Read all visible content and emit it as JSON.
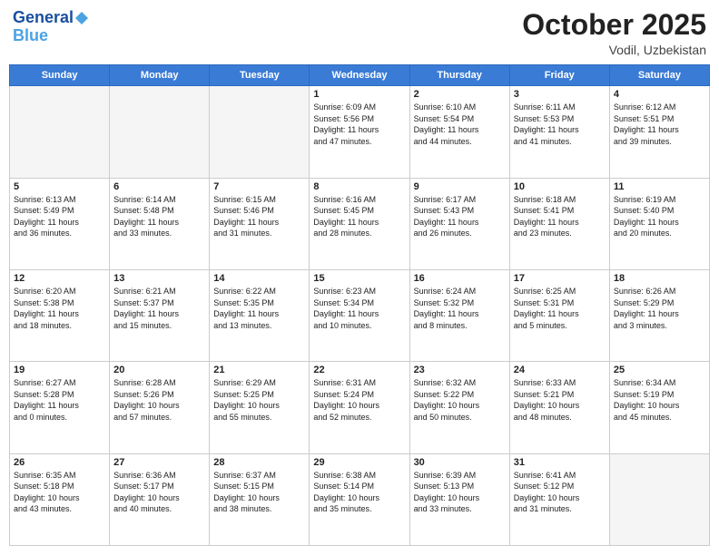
{
  "header": {
    "logo_line1": "General",
    "logo_line2": "Blue",
    "month": "October 2025",
    "location": "Vodil, Uzbekistan"
  },
  "days_of_week": [
    "Sunday",
    "Monday",
    "Tuesday",
    "Wednesday",
    "Thursday",
    "Friday",
    "Saturday"
  ],
  "weeks": [
    [
      {
        "day": "",
        "info": ""
      },
      {
        "day": "",
        "info": ""
      },
      {
        "day": "",
        "info": ""
      },
      {
        "day": "1",
        "info": "Sunrise: 6:09 AM\nSunset: 5:56 PM\nDaylight: 11 hours\nand 47 minutes."
      },
      {
        "day": "2",
        "info": "Sunrise: 6:10 AM\nSunset: 5:54 PM\nDaylight: 11 hours\nand 44 minutes."
      },
      {
        "day": "3",
        "info": "Sunrise: 6:11 AM\nSunset: 5:53 PM\nDaylight: 11 hours\nand 41 minutes."
      },
      {
        "day": "4",
        "info": "Sunrise: 6:12 AM\nSunset: 5:51 PM\nDaylight: 11 hours\nand 39 minutes."
      }
    ],
    [
      {
        "day": "5",
        "info": "Sunrise: 6:13 AM\nSunset: 5:49 PM\nDaylight: 11 hours\nand 36 minutes."
      },
      {
        "day": "6",
        "info": "Sunrise: 6:14 AM\nSunset: 5:48 PM\nDaylight: 11 hours\nand 33 minutes."
      },
      {
        "day": "7",
        "info": "Sunrise: 6:15 AM\nSunset: 5:46 PM\nDaylight: 11 hours\nand 31 minutes."
      },
      {
        "day": "8",
        "info": "Sunrise: 6:16 AM\nSunset: 5:45 PM\nDaylight: 11 hours\nand 28 minutes."
      },
      {
        "day": "9",
        "info": "Sunrise: 6:17 AM\nSunset: 5:43 PM\nDaylight: 11 hours\nand 26 minutes."
      },
      {
        "day": "10",
        "info": "Sunrise: 6:18 AM\nSunset: 5:41 PM\nDaylight: 11 hours\nand 23 minutes."
      },
      {
        "day": "11",
        "info": "Sunrise: 6:19 AM\nSunset: 5:40 PM\nDaylight: 11 hours\nand 20 minutes."
      }
    ],
    [
      {
        "day": "12",
        "info": "Sunrise: 6:20 AM\nSunset: 5:38 PM\nDaylight: 11 hours\nand 18 minutes."
      },
      {
        "day": "13",
        "info": "Sunrise: 6:21 AM\nSunset: 5:37 PM\nDaylight: 11 hours\nand 15 minutes."
      },
      {
        "day": "14",
        "info": "Sunrise: 6:22 AM\nSunset: 5:35 PM\nDaylight: 11 hours\nand 13 minutes."
      },
      {
        "day": "15",
        "info": "Sunrise: 6:23 AM\nSunset: 5:34 PM\nDaylight: 11 hours\nand 10 minutes."
      },
      {
        "day": "16",
        "info": "Sunrise: 6:24 AM\nSunset: 5:32 PM\nDaylight: 11 hours\nand 8 minutes."
      },
      {
        "day": "17",
        "info": "Sunrise: 6:25 AM\nSunset: 5:31 PM\nDaylight: 11 hours\nand 5 minutes."
      },
      {
        "day": "18",
        "info": "Sunrise: 6:26 AM\nSunset: 5:29 PM\nDaylight: 11 hours\nand 3 minutes."
      }
    ],
    [
      {
        "day": "19",
        "info": "Sunrise: 6:27 AM\nSunset: 5:28 PM\nDaylight: 11 hours\nand 0 minutes."
      },
      {
        "day": "20",
        "info": "Sunrise: 6:28 AM\nSunset: 5:26 PM\nDaylight: 10 hours\nand 57 minutes."
      },
      {
        "day": "21",
        "info": "Sunrise: 6:29 AM\nSunset: 5:25 PM\nDaylight: 10 hours\nand 55 minutes."
      },
      {
        "day": "22",
        "info": "Sunrise: 6:31 AM\nSunset: 5:24 PM\nDaylight: 10 hours\nand 52 minutes."
      },
      {
        "day": "23",
        "info": "Sunrise: 6:32 AM\nSunset: 5:22 PM\nDaylight: 10 hours\nand 50 minutes."
      },
      {
        "day": "24",
        "info": "Sunrise: 6:33 AM\nSunset: 5:21 PM\nDaylight: 10 hours\nand 48 minutes."
      },
      {
        "day": "25",
        "info": "Sunrise: 6:34 AM\nSunset: 5:19 PM\nDaylight: 10 hours\nand 45 minutes."
      }
    ],
    [
      {
        "day": "26",
        "info": "Sunrise: 6:35 AM\nSunset: 5:18 PM\nDaylight: 10 hours\nand 43 minutes."
      },
      {
        "day": "27",
        "info": "Sunrise: 6:36 AM\nSunset: 5:17 PM\nDaylight: 10 hours\nand 40 minutes."
      },
      {
        "day": "28",
        "info": "Sunrise: 6:37 AM\nSunset: 5:15 PM\nDaylight: 10 hours\nand 38 minutes."
      },
      {
        "day": "29",
        "info": "Sunrise: 6:38 AM\nSunset: 5:14 PM\nDaylight: 10 hours\nand 35 minutes."
      },
      {
        "day": "30",
        "info": "Sunrise: 6:39 AM\nSunset: 5:13 PM\nDaylight: 10 hours\nand 33 minutes."
      },
      {
        "day": "31",
        "info": "Sunrise: 6:41 AM\nSunset: 5:12 PM\nDaylight: 10 hours\nand 31 minutes."
      },
      {
        "day": "",
        "info": ""
      }
    ]
  ]
}
